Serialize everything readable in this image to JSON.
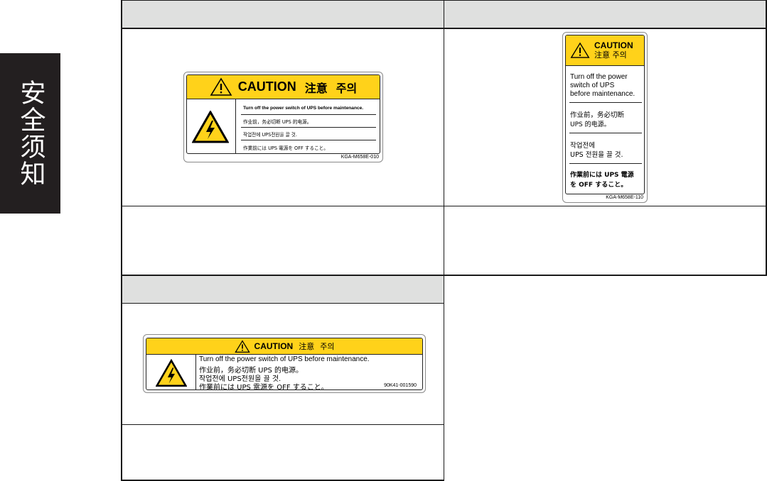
{
  "side_tab": {
    "text": "安全须知"
  },
  "labels": {
    "label1": {
      "caution": "CAUTION",
      "zh": "注意",
      "ko": "주의",
      "lines": [
        "Turn off the power switch of UPS before maintenance.",
        "作业前，务必切断 UPS 的电源。",
        "작업전에 UPS전원을 끌 것.",
        "作業前には UPS 電源を OFF すること。"
      ],
      "code": "KGA-M658E-010"
    },
    "label2": {
      "caution": "CAUTION",
      "zh_ko": "注意 주의",
      "lines": [
        "Turn off the power",
        "switch of UPS",
        "before maintenance.",
        "作业前，务必切断",
        "UPS 的电源。",
        "작업전에",
        "UPS 전원을 끌 것.",
        "作業前には UPS 電源",
        "を OFF すること。"
      ],
      "code": "KGA-M658E-110"
    },
    "label3": {
      "caution": "CAUTION",
      "zh": "注意",
      "ko": "주의",
      "lines": [
        "Turn off the power switch of UPS before maintenance.",
        "作业前，务必切断 UPS 的电源。",
        "작업전에 UPS전원을 끌 것.",
        "作業前には UPS 電源を OFF すること。"
      ],
      "code": "90K41-001590"
    }
  },
  "colors": {
    "caution_yellow": "#ffd21a",
    "header_gray": "#dfe0df",
    "tab_dark": "#231f20"
  },
  "icons": {
    "warning": "exclamation-triangle-icon",
    "shock": "electric-shock-icon"
  }
}
